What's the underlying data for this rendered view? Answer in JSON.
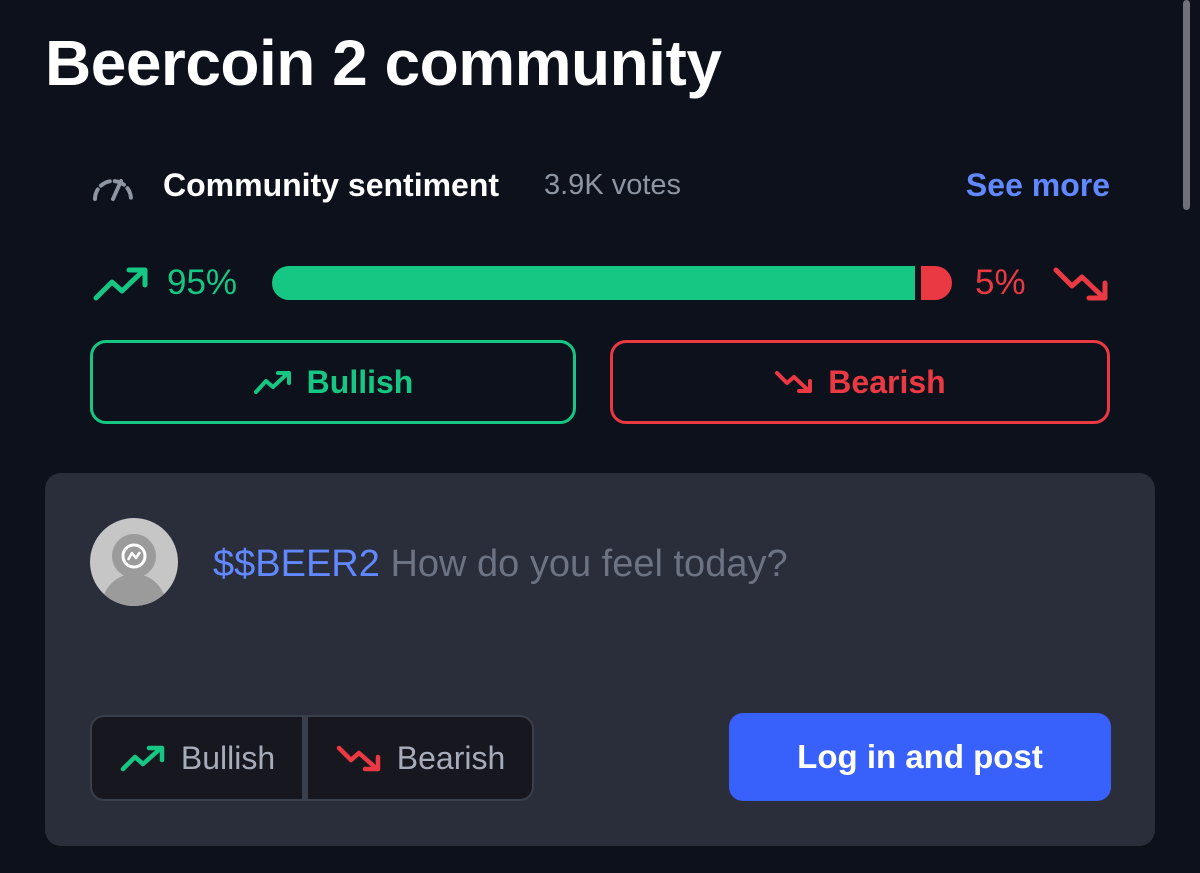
{
  "page": {
    "title": "Beercoin 2 community"
  },
  "sentiment": {
    "label": "Community sentiment",
    "votes": "3.9K votes",
    "see_more": "See more",
    "bullish_pct_text": "95%",
    "bearish_pct_text": "5%",
    "bullish_fraction": 0.95,
    "bearish_fraction": 0.05
  },
  "vote_buttons": {
    "bullish_label": "Bullish",
    "bearish_label": "Bearish"
  },
  "post": {
    "ticker": "$$BEER2",
    "placeholder": " How do you feel today?",
    "toggle_bullish": "Bullish",
    "toggle_bearish": "Bearish",
    "login_button": "Log in and post"
  },
  "colors": {
    "background": "#0c111b",
    "bullish": "#16c784",
    "bearish": "#ea3943",
    "accent": "#3861fb",
    "link": "#6188ff",
    "panel": "#2a2e3b"
  },
  "icons": {
    "sentiment": "gauge-icon",
    "bullish": "trend-up-icon",
    "bearish": "trend-down-icon",
    "avatar": "user-avatar-icon"
  }
}
